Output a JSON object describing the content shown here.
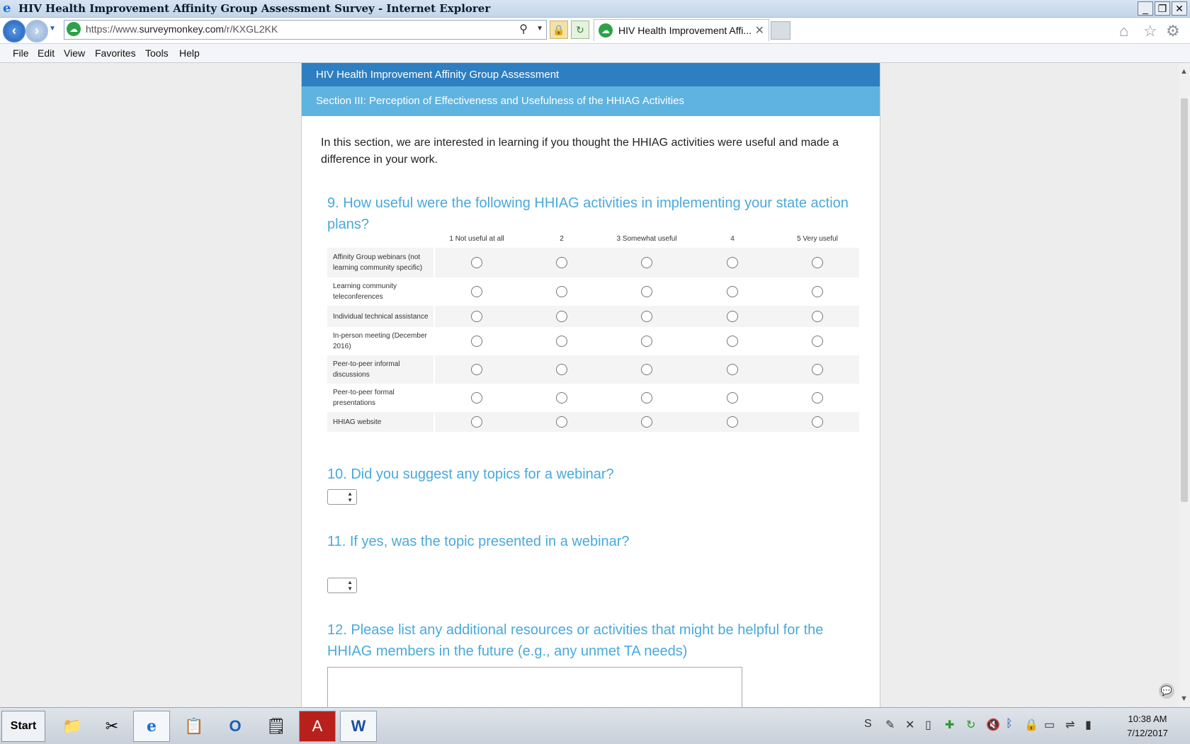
{
  "window": {
    "title": "HIV Health Improvement Affinity Group Assessment Survey - Internet Explorer",
    "controls": [
      "_",
      "❐",
      "✕"
    ]
  },
  "address_bar": {
    "url_prefix": "https://www.",
    "url_host": "surveymonkey.com",
    "url_path": "/r/KXGL2KK"
  },
  "tab": {
    "label": "HIV Health Improvement Affi...",
    "close": "✕"
  },
  "menu": [
    "File",
    "Edit",
    "View",
    "Favorites",
    "Tools",
    "Help"
  ],
  "survey": {
    "title": "HIV Health Improvement Affinity Group Assessment",
    "section": "Section III: Perception of Effectiveness and Usefulness of the HHIAG Activities",
    "intro": "In this section, we are interested in learning if you thought the HHIAG activities were useful and made a difference in your work.",
    "q9": {
      "text": "9. How useful were the following HHIAG activities in implementing your state action plans?",
      "columns": [
        "1 Not useful at all",
        "2",
        "3 Somewhat useful",
        "4",
        "5 Very useful"
      ],
      "rows": [
        "Affinity Group webinars (not learning community specific)",
        "Learning community teleconferences",
        "Individual technical assistance",
        "In-person meeting (December 2016)",
        "Peer-to-peer informal discussions",
        "Peer-to-peer formal presentations",
        "HHIAG website"
      ]
    },
    "q10": {
      "text": "10. Did you suggest any topics for a webinar?",
      "value": ""
    },
    "q11": {
      "text": "11. If yes, was the topic presented in a webinar?",
      "value": ""
    },
    "q12": {
      "text": "12. Please list any additional resources or activities that might be helpful for the HHIAG members in the future (e.g., any unmet TA needs)",
      "value": ""
    }
  },
  "taskbar": {
    "start_label": "Start",
    "time": "10:38 AM",
    "date": "7/12/2017"
  },
  "colors": {
    "header_dark": "#2d7fc1",
    "header_light": "#5fb3e0",
    "question": "#49a9dc"
  }
}
